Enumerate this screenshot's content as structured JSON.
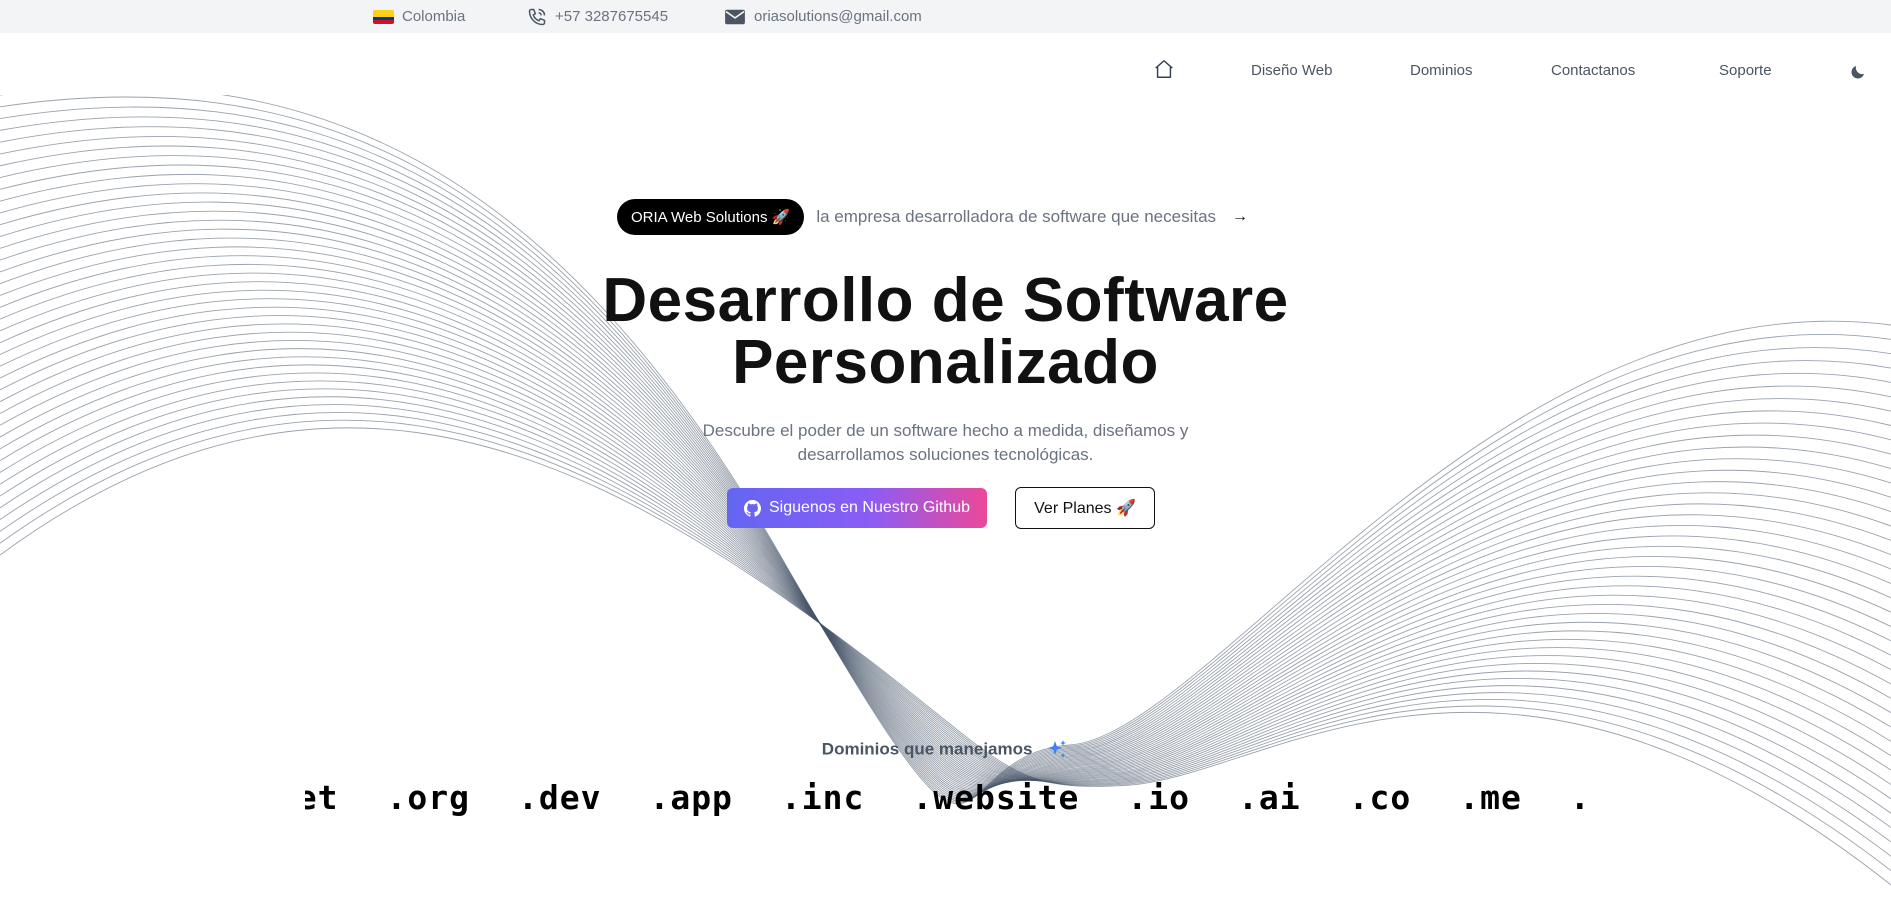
{
  "topbar": {
    "country": "Colombia",
    "phone": "+57 3287675545",
    "email": "oriasolutions@gmail.com"
  },
  "nav": {
    "items": [
      {
        "label": "Diseño Web"
      },
      {
        "label": "Dominios"
      },
      {
        "label": "Contactanos"
      },
      {
        "label": "Soporte"
      }
    ]
  },
  "hero": {
    "pill": "ORIA Web Solutions 🚀",
    "tagline": "la empresa desarrolladora de software que necesitas",
    "title_line1": "Desarrollo de Software",
    "title_line2": "Personalizado",
    "desc_line1": "Descubre el poder de un software hecho a medida, diseñamos y",
    "desc_line2": "desarrollamos soluciones tecnológicas.",
    "github_button": "Siguenos en Nuestro Github",
    "plans_button": "Ver Planes 🚀"
  },
  "domains": {
    "title": "Dominios que manejamos",
    "items": [
      ".net",
      ".org",
      ".dev",
      ".app",
      ".inc",
      ".website",
      ".io",
      ".ai",
      ".co",
      ".me",
      ".com"
    ]
  },
  "colors": {
    "accent_start": "#6366f1",
    "accent_end": "#ec4899",
    "topbar_bg": "#f3f4f6",
    "wave_stroke": "#475569"
  }
}
